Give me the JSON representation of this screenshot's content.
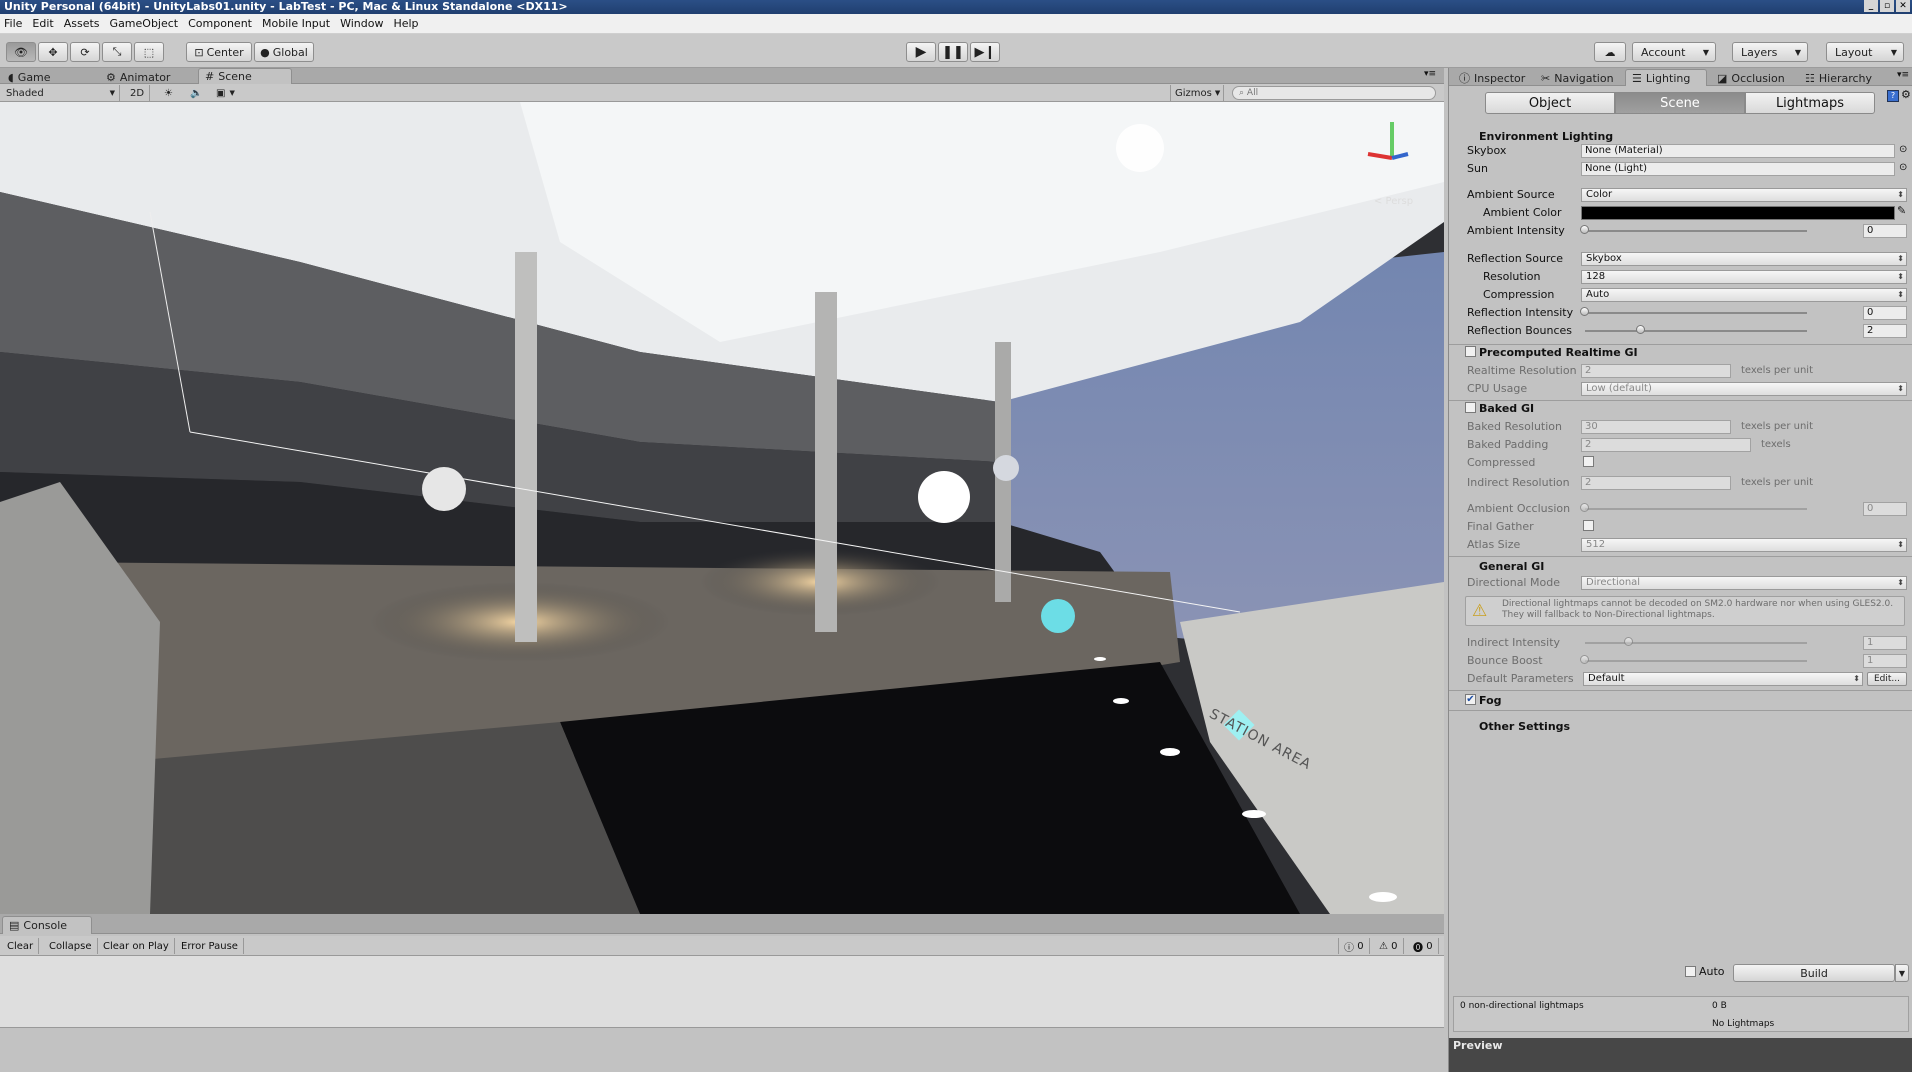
{
  "window": {
    "title": "Unity Personal (64bit) - UnityLabs01.unity - LabTest - PC, Mac & Linux Standalone <DX11>"
  },
  "menu": [
    "File",
    "Edit",
    "Assets",
    "GameObject",
    "Component",
    "Mobile Input",
    "Window",
    "Help"
  ],
  "toolbar": {
    "center": "Center",
    "global": "Global",
    "account": "Account",
    "layers": "Layers",
    "layout": "Layout"
  },
  "tabs_left": {
    "game": "Game",
    "animator": "Animator",
    "scene": "Scene"
  },
  "scenebar": {
    "shaded": "Shaded",
    "mode2d": "2D",
    "gizmos": "Gizmos",
    "search_placeholder": "All"
  },
  "viewport": {
    "persp": "< Persp",
    "sign": "STATION AREA"
  },
  "console": {
    "tab": "Console",
    "clear": "Clear",
    "collapse": "Collapse",
    "clear_on_play": "Clear on Play",
    "error_pause": "Error Pause",
    "count_info": "0",
    "count_warn": "0",
    "count_err": "0"
  },
  "panel_tabs": {
    "inspector": "Inspector",
    "navigation": "Navigation",
    "lighting": "Lighting",
    "occlusion": "Occlusion",
    "hierarchy": "Hierarchy"
  },
  "segments": {
    "object": "Object",
    "scene": "Scene",
    "lightmaps": "Lightmaps"
  },
  "env": {
    "header": "Environment Lighting",
    "skybox_label": "Skybox",
    "skybox_value": "None (Material)",
    "sun_label": "Sun",
    "sun_value": "None (Light)",
    "ambient_source_label": "Ambient Source",
    "ambient_source_value": "Color",
    "ambient_color_label": "Ambient Color",
    "ambient_color_hex": "#000000",
    "ambient_intensity_label": "Ambient Intensity",
    "ambient_intensity_value": "0",
    "ambient_intensity_frac": 0.0,
    "reflection_source_label": "Reflection Source",
    "reflection_source_value": "Skybox",
    "resolution_label": "Resolution",
    "resolution_value": "128",
    "compression_label": "Compression",
    "compression_value": "Auto",
    "reflection_intensity_label": "Reflection Intensity",
    "reflection_intensity_value": "0",
    "reflection_intensity_frac": 0.0,
    "reflection_bounces_label": "Reflection Bounces",
    "reflection_bounces_value": "2",
    "reflection_bounces_frac": 0.25
  },
  "realtime": {
    "header": "Precomputed Realtime GI",
    "res_label": "Realtime Resolution",
    "res_value": "2",
    "res_unit": "texels per unit",
    "cpu_label": "CPU Usage",
    "cpu_value": "Low (default)"
  },
  "baked": {
    "header": "Baked GI",
    "res_label": "Baked Resolution",
    "res_value": "30",
    "res_unit": "texels per unit",
    "pad_label": "Baked Padding",
    "pad_value": "2",
    "pad_unit": "texels",
    "compressed_label": "Compressed",
    "indirect_label": "Indirect Resolution",
    "indirect_value": "2",
    "indirect_unit": "texels per unit",
    "ao_label": "Ambient Occlusion",
    "ao_value": "0",
    "final_gather_label": "Final Gather",
    "atlas_label": "Atlas Size",
    "atlas_value": "512"
  },
  "general": {
    "header": "General GI",
    "dir_label": "Directional Mode",
    "dir_value": "Directional",
    "warning": "Directional lightmaps cannot be decoded on SM2.0 hardware nor when using GLES2.0. They will fallback to Non-Directional lightmaps.",
    "indirect_label": "Indirect Intensity",
    "indirect_value": "1",
    "indirect_frac": 0.2,
    "bounce_label": "Bounce Boost",
    "bounce_value": "1",
    "bounce_frac": 0.0,
    "defaults_label": "Default Parameters",
    "defaults_value": "Default",
    "edit": "Edit..."
  },
  "fog": {
    "label": "Fog"
  },
  "other": {
    "label": "Other Settings"
  },
  "footer": {
    "auto": "Auto",
    "build": "Build",
    "lightmaps_info": "0 non-directional lightmaps",
    "size": "0 B",
    "no_lightmaps": "No Lightmaps",
    "preview": "Preview"
  },
  "colors": {
    "accent": "#2b4f86",
    "panel_bg": "#c2c2c2",
    "sky": "#6a7fa8"
  }
}
